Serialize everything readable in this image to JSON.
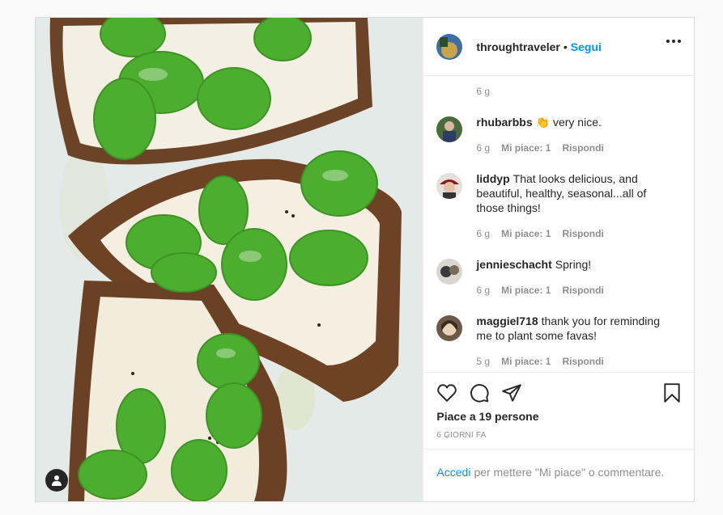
{
  "header": {
    "username": "throughtraveler",
    "separator": "•",
    "follow_label": "Segui",
    "avatar_icon": "profile-avatar"
  },
  "caption_time": "6 g",
  "comments": [
    {
      "user": "rhubarbbs",
      "emoji": "👏",
      "text": "very nice.",
      "time": "6 g",
      "likes": "Mi piace: 1",
      "reply": "Rispondi"
    },
    {
      "user": "liddyp",
      "text": "That looks delicious, and beautiful, healthy, seasonal...all of those things!",
      "time": "6 g",
      "likes": "Mi piace: 1",
      "reply": "Rispondi"
    },
    {
      "user": "jenniesсhacht",
      "text": "Spring!",
      "time": "6 g",
      "likes": "Mi piace: 1",
      "reply": "Rispondi"
    },
    {
      "user": "maggiel718",
      "text": "thank you for reminding me to plant some favas!",
      "time": "5 g",
      "likes": "Mi piace: 1",
      "reply": "Rispondi"
    }
  ],
  "actions": {
    "like_icon": "heart-icon",
    "comment_icon": "comment-icon",
    "share_icon": "paper-plane-icon",
    "save_icon": "bookmark-icon"
  },
  "likes_text": "Piace a 19 persone",
  "posted": "6 GIORNI FA",
  "login": {
    "link": "Accedi",
    "rest": "per mettere \"Mi piace\" o commentare."
  },
  "colors": {
    "accent": "#0095f6",
    "muted": "#8e8e8e",
    "text": "#262626",
    "border": "#dbdbdb"
  }
}
